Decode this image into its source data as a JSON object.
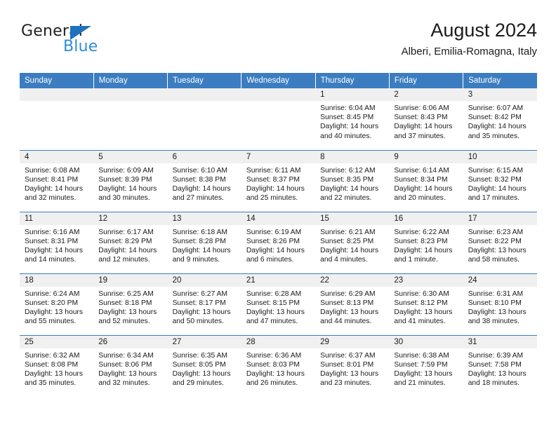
{
  "brand": {
    "name_top": "General",
    "name_bottom": "Blue",
    "flag_icon": "triangle-flag-icon",
    "accent_color": "#1f72bd",
    "secondary_color": "#2d8fd5"
  },
  "header": {
    "title": "August 2024",
    "subtitle": "Alberi, Emilia-Romagna, Italy"
  },
  "calendar": {
    "header_bg": "#3b7dc0",
    "daynum_bg": "#f0f0f0",
    "weekday_headers": [
      "Sunday",
      "Monday",
      "Tuesday",
      "Wednesday",
      "Thursday",
      "Friday",
      "Saturday"
    ],
    "weeks": [
      [
        {
          "day": "",
          "lines": []
        },
        {
          "day": "",
          "lines": []
        },
        {
          "day": "",
          "lines": []
        },
        {
          "day": "",
          "lines": []
        },
        {
          "day": "1",
          "lines": [
            "Sunrise: 6:04 AM",
            "Sunset: 8:45 PM",
            "Daylight: 14 hours",
            "and 40 minutes."
          ]
        },
        {
          "day": "2",
          "lines": [
            "Sunrise: 6:06 AM",
            "Sunset: 8:43 PM",
            "Daylight: 14 hours",
            "and 37 minutes."
          ]
        },
        {
          "day": "3",
          "lines": [
            "Sunrise: 6:07 AM",
            "Sunset: 8:42 PM",
            "Daylight: 14 hours",
            "and 35 minutes."
          ]
        }
      ],
      [
        {
          "day": "4",
          "lines": [
            "Sunrise: 6:08 AM",
            "Sunset: 8:41 PM",
            "Daylight: 14 hours",
            "and 32 minutes."
          ]
        },
        {
          "day": "5",
          "lines": [
            "Sunrise: 6:09 AM",
            "Sunset: 8:39 PM",
            "Daylight: 14 hours",
            "and 30 minutes."
          ]
        },
        {
          "day": "6",
          "lines": [
            "Sunrise: 6:10 AM",
            "Sunset: 8:38 PM",
            "Daylight: 14 hours",
            "and 27 minutes."
          ]
        },
        {
          "day": "7",
          "lines": [
            "Sunrise: 6:11 AM",
            "Sunset: 8:37 PM",
            "Daylight: 14 hours",
            "and 25 minutes."
          ]
        },
        {
          "day": "8",
          "lines": [
            "Sunrise: 6:12 AM",
            "Sunset: 8:35 PM",
            "Daylight: 14 hours",
            "and 22 minutes."
          ]
        },
        {
          "day": "9",
          "lines": [
            "Sunrise: 6:14 AM",
            "Sunset: 8:34 PM",
            "Daylight: 14 hours",
            "and 20 minutes."
          ]
        },
        {
          "day": "10",
          "lines": [
            "Sunrise: 6:15 AM",
            "Sunset: 8:32 PM",
            "Daylight: 14 hours",
            "and 17 minutes."
          ]
        }
      ],
      [
        {
          "day": "11",
          "lines": [
            "Sunrise: 6:16 AM",
            "Sunset: 8:31 PM",
            "Daylight: 14 hours",
            "and 14 minutes."
          ]
        },
        {
          "day": "12",
          "lines": [
            "Sunrise: 6:17 AM",
            "Sunset: 8:29 PM",
            "Daylight: 14 hours",
            "and 12 minutes."
          ]
        },
        {
          "day": "13",
          "lines": [
            "Sunrise: 6:18 AM",
            "Sunset: 8:28 PM",
            "Daylight: 14 hours",
            "and 9 minutes."
          ]
        },
        {
          "day": "14",
          "lines": [
            "Sunrise: 6:19 AM",
            "Sunset: 8:26 PM",
            "Daylight: 14 hours",
            "and 6 minutes."
          ]
        },
        {
          "day": "15",
          "lines": [
            "Sunrise: 6:21 AM",
            "Sunset: 8:25 PM",
            "Daylight: 14 hours",
            "and 4 minutes."
          ]
        },
        {
          "day": "16",
          "lines": [
            "Sunrise: 6:22 AM",
            "Sunset: 8:23 PM",
            "Daylight: 14 hours",
            "and 1 minute."
          ]
        },
        {
          "day": "17",
          "lines": [
            "Sunrise: 6:23 AM",
            "Sunset: 8:22 PM",
            "Daylight: 13 hours",
            "and 58 minutes."
          ]
        }
      ],
      [
        {
          "day": "18",
          "lines": [
            "Sunrise: 6:24 AM",
            "Sunset: 8:20 PM",
            "Daylight: 13 hours",
            "and 55 minutes."
          ]
        },
        {
          "day": "19",
          "lines": [
            "Sunrise: 6:25 AM",
            "Sunset: 8:18 PM",
            "Daylight: 13 hours",
            "and 52 minutes."
          ]
        },
        {
          "day": "20",
          "lines": [
            "Sunrise: 6:27 AM",
            "Sunset: 8:17 PM",
            "Daylight: 13 hours",
            "and 50 minutes."
          ]
        },
        {
          "day": "21",
          "lines": [
            "Sunrise: 6:28 AM",
            "Sunset: 8:15 PM",
            "Daylight: 13 hours",
            "and 47 minutes."
          ]
        },
        {
          "day": "22",
          "lines": [
            "Sunrise: 6:29 AM",
            "Sunset: 8:13 PM",
            "Daylight: 13 hours",
            "and 44 minutes."
          ]
        },
        {
          "day": "23",
          "lines": [
            "Sunrise: 6:30 AM",
            "Sunset: 8:12 PM",
            "Daylight: 13 hours",
            "and 41 minutes."
          ]
        },
        {
          "day": "24",
          "lines": [
            "Sunrise: 6:31 AM",
            "Sunset: 8:10 PM",
            "Daylight: 13 hours",
            "and 38 minutes."
          ]
        }
      ],
      [
        {
          "day": "25",
          "lines": [
            "Sunrise: 6:32 AM",
            "Sunset: 8:08 PM",
            "Daylight: 13 hours",
            "and 35 minutes."
          ]
        },
        {
          "day": "26",
          "lines": [
            "Sunrise: 6:34 AM",
            "Sunset: 8:06 PM",
            "Daylight: 13 hours",
            "and 32 minutes."
          ]
        },
        {
          "day": "27",
          "lines": [
            "Sunrise: 6:35 AM",
            "Sunset: 8:05 PM",
            "Daylight: 13 hours",
            "and 29 minutes."
          ]
        },
        {
          "day": "28",
          "lines": [
            "Sunrise: 6:36 AM",
            "Sunset: 8:03 PM",
            "Daylight: 13 hours",
            "and 26 minutes."
          ]
        },
        {
          "day": "29",
          "lines": [
            "Sunrise: 6:37 AM",
            "Sunset: 8:01 PM",
            "Daylight: 13 hours",
            "and 23 minutes."
          ]
        },
        {
          "day": "30",
          "lines": [
            "Sunrise: 6:38 AM",
            "Sunset: 7:59 PM",
            "Daylight: 13 hours",
            "and 21 minutes."
          ]
        },
        {
          "day": "31",
          "lines": [
            "Sunrise: 6:39 AM",
            "Sunset: 7:58 PM",
            "Daylight: 13 hours",
            "and 18 minutes."
          ]
        }
      ]
    ]
  }
}
